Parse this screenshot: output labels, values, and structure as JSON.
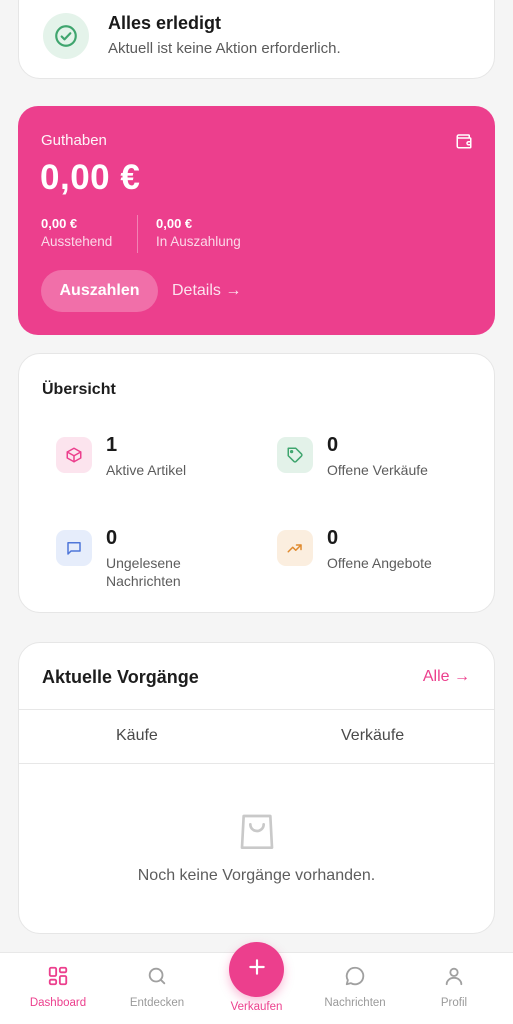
{
  "status": {
    "title": "Alles erledigt",
    "subtitle": "Aktuell ist keine Aktion erforderlich."
  },
  "balance": {
    "label": "Guthaben",
    "amount": "0,00 €",
    "pending_value": "0,00 €",
    "pending_label": "Ausstehend",
    "payout_value": "0,00 €",
    "payout_label": "In Auszahlung",
    "payout_button": "Auszahlen",
    "details_link": "Details →"
  },
  "overview": {
    "title": "Übersicht",
    "stats": [
      {
        "value": "1",
        "label": "Aktive Artikel",
        "icon": "package-icon",
        "color": "#ec3f8d"
      },
      {
        "value": "0",
        "label": "Offene Verkäufe",
        "icon": "tag-icon",
        "color": "#3fa56e"
      },
      {
        "value": "0",
        "label": "Ungelesene\nNachrichten",
        "icon": "message-icon",
        "color": "#4f76d9"
      },
      {
        "value": "0",
        "label": "Offene Angebote",
        "icon": "trending-up-icon",
        "color": "#e08a2e"
      }
    ]
  },
  "activity": {
    "title": "Aktuelle Vorgänge",
    "all_link": "Alle →",
    "tabs": [
      "Käufe",
      "Verkäufe"
    ],
    "empty_text": "Noch keine Vorgänge vorhanden."
  },
  "nav": {
    "items": [
      {
        "label": "Dashboard",
        "icon": "dashboard-icon",
        "active": true
      },
      {
        "label": "Entdecken",
        "icon": "search-icon",
        "active": false
      },
      {
        "label": "Verkaufen",
        "icon": "plus-icon",
        "active": false
      },
      {
        "label": "Nachrichten",
        "icon": "message-icon",
        "active": false
      },
      {
        "label": "Profil",
        "icon": "user-icon",
        "active": false
      }
    ]
  },
  "colors": {
    "accent": "#ec3f8d",
    "success": "#3fa56e"
  }
}
